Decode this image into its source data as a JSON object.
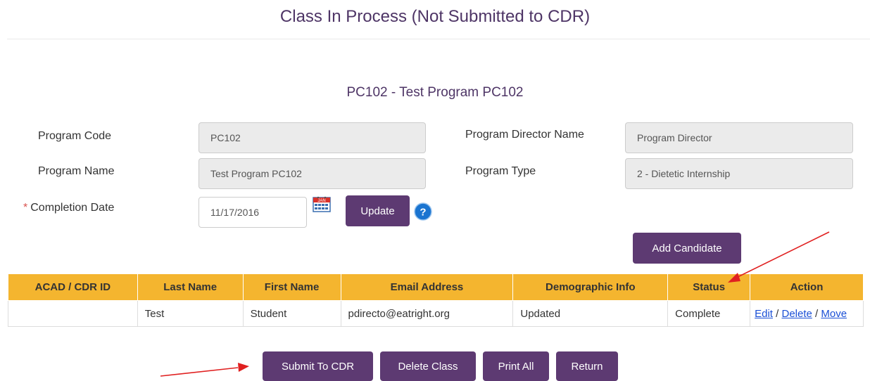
{
  "page": {
    "title": "Class In Process (Not Submitted to CDR)"
  },
  "program": {
    "heading": "PC102 - Test Program PC102",
    "code_label": "Program Code",
    "code_value": "PC102",
    "name_label": "Program Name",
    "name_value": "Test Program PC102",
    "director_label": "Program Director Name",
    "director_value": "Program Director",
    "type_label": "Program Type",
    "type_value": "2 - Dietetic Internship",
    "required_marker": "*",
    "completion_label": "Completion Date",
    "completion_value": "11/17/2016",
    "calendar_month": "JAN",
    "update_label": "Update",
    "help_glyph": "?"
  },
  "add_candidate_label": "Add Candidate",
  "table": {
    "headers": [
      "ACAD / CDR ID",
      "Last Name",
      "First Name",
      "Email Address",
      "Demographic Info",
      "Status",
      "Action"
    ],
    "rows": [
      {
        "id": "",
        "last_name": "Test",
        "first_name": "Student",
        "email": "pdirecto@eatright.org",
        "demographic": "Updated",
        "status": "Complete",
        "actions": {
          "edit": "Edit",
          "sep1": "/",
          "delete": "Delete",
          "sep2": "/",
          "move": "Move"
        }
      }
    ]
  },
  "footer_buttons": {
    "submit": "Submit To CDR",
    "delete_class": "Delete Class",
    "print_all": "Print All",
    "return": "Return"
  },
  "colors": {
    "brand_purple": "#5d3a72",
    "header_gold": "#f4b52f",
    "annotation_red": "#e02020",
    "link_blue": "#1a4fd6"
  }
}
